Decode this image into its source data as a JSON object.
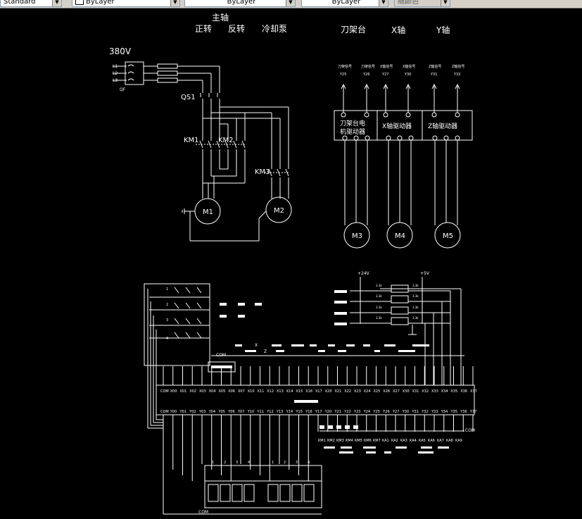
{
  "toolbar": {
    "text_style": "Standard",
    "linetype": "ByLayer",
    "lineweight": "ByLayer",
    "plotstyle": "ByLayer",
    "color": "随颜色"
  },
  "colors": {
    "background": "#000000",
    "lines": "#ffffff",
    "toolbar": "#d4d0c8"
  },
  "drawing": {
    "headers": {
      "main_spindle": "主轴",
      "forward": "正转",
      "reverse": "反转",
      "coolant_pump": "冷却泵",
      "tool_turret": "刀架台",
      "x_axis": "X轴",
      "y_axis": "Y轴"
    },
    "power": {
      "voltage": "380V",
      "phase_labels": [
        "L1",
        "L2",
        "L3"
      ],
      "qf": "QF",
      "qs1": "QS1",
      "km1": "KM1",
      "km2": "KM2",
      "km3": "KM3",
      "m1": "M1",
      "m2": "M2"
    },
    "signals": [
      {
        "caption": "刀架信号",
        "id": "Y25"
      },
      {
        "caption": "刀架信号",
        "id": "Y26"
      },
      {
        "caption": "X轴信号",
        "id": "Y27"
      },
      {
        "caption": "X轴信号",
        "id": "Y30"
      },
      {
        "caption": "Z轴信号",
        "id": "Y31"
      },
      {
        "caption": "Z轴信号",
        "id": "Y32"
      }
    ],
    "drivers": {
      "turret_line1": "刀架台电",
      "turret_line2": "机驱动器",
      "x_driver": "X轴驱动器",
      "z_driver": "Z轴驱动器"
    },
    "motors": {
      "m3": "M3",
      "m4": "M4",
      "m5": "M5"
    },
    "plc": {
      "top_row": [
        "COM",
        "X00",
        "X01",
        "X02",
        "X03",
        "X04",
        "X05",
        "X06",
        "X07",
        "X10",
        "X11",
        "X12",
        "X13",
        "X14",
        "X15",
        "X16",
        "X17",
        "X20",
        "X21",
        "X22",
        "X23",
        "X24",
        "X25",
        "X26",
        "X27",
        "X30",
        "X31",
        "X32",
        "X33",
        "X34",
        "X35",
        "X36",
        "X37"
      ],
      "bottom_row": [
        "COM",
        "Y00",
        "Y01",
        "Y02",
        "Y03",
        "Y04",
        "Y05",
        "Y06",
        "Y07",
        "Y10",
        "Y11",
        "Y12",
        "Y13",
        "Y14",
        "Y15",
        "Y16",
        "Y17",
        "Y20",
        "Y21",
        "Y22",
        "Y23",
        "Y24",
        "Y25",
        "Y26",
        "Y27",
        "Y30",
        "Y31",
        "Y32",
        "Y33",
        "Y34",
        "Y35",
        "Y36",
        "Y37"
      ],
      "relays": [
        "KM1",
        "KM2",
        "KM3",
        "KM4",
        "KM5",
        "KM6",
        "KM7",
        "KA1",
        "KA2",
        "KA3",
        "KA4",
        "KA5",
        "KA6",
        "KA7",
        "KA8",
        "KA9"
      ],
      "com": "COM",
      "com_label": "COM",
      "z_label": "Z",
      "x_label": "X",
      "com0": "COM"
    },
    "supply": {
      "plus24": "+24V",
      "plus5": "+5V"
    },
    "resistor_labels": [
      "3.3k",
      "3.3k",
      "3.3k",
      "3.3k",
      "3.3k",
      "3.3k",
      "3.3k",
      "3.3k"
    ],
    "display_numbers": [
      "1",
      "2",
      "3",
      "4",
      "1",
      "2",
      "3",
      "4"
    ],
    "switch_numbers": [
      "1",
      "2",
      "3",
      "4"
    ]
  }
}
